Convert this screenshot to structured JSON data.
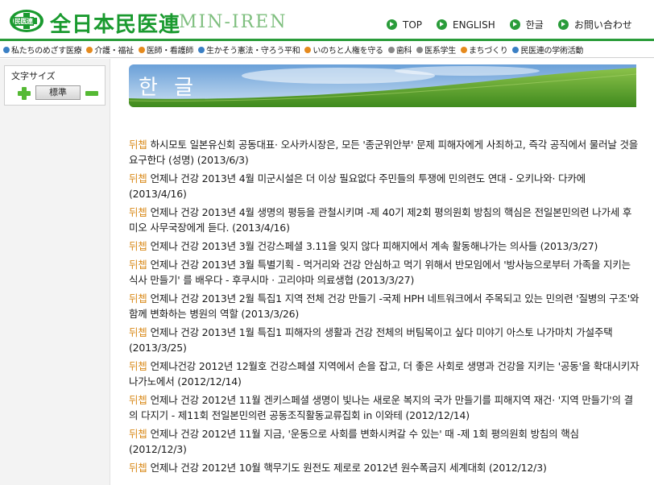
{
  "header": {
    "logo_badge": "民医連",
    "title": "全日本民医連",
    "subtitle": "MIN-IREN",
    "top_nav": [
      "TOP",
      "ENGLISH",
      "한글",
      "お問い合わせ"
    ]
  },
  "subnav": [
    {
      "label": "私たちのめざす医療",
      "color": "#3a7fc4"
    },
    {
      "label": "介護・福祉",
      "color": "#e58a1e"
    },
    {
      "label": "医師・看護師",
      "color": "#e58a1e"
    },
    {
      "label": "生かそう憲法・守ろう平和",
      "color": "#3a7fc4"
    },
    {
      "label": "いのちと人権を守る",
      "color": "#e58a1e"
    },
    {
      "label": "歯科",
      "color": "#888888"
    },
    {
      "label": "医系学生",
      "color": "#888888"
    },
    {
      "label": "まちづくり",
      "color": "#e58a1e"
    },
    {
      "label": "民医連の学術活動",
      "color": "#3a7fc4"
    }
  ],
  "sidebar": {
    "font_size_label": "文字サイズ",
    "standard_label": "標準"
  },
  "banner": {
    "title": "한 글"
  },
  "news": [
    {
      "tag": "뒤쳅",
      "text": "하시모토 일본유신회 공동대표· 오사카시장은,  모든 '종군위안부' 문제 피해자에게 사죄하고,  즉각 공직에서 물러날 것을 요구한다 (성명)  (2013/6/3)"
    },
    {
      "tag": "뒤쳅",
      "text": "언제나 건강 2013년 4월     미군시설은 더 이상 필요없다     주민들의 투쟁에 민의련도 연대 - 오키나와· 다카에     (2013/4/16)"
    },
    {
      "tag": "뒤쳅",
      "text": "언제나 건강 2013년 4월     생명의 평등을 관철시키며     -제 40기 제2회 평의원회 방침의 핵심은     전일본민의련 나가세 후미오 사무국장에게 듣다.    (2013/4/16)"
    },
    {
      "tag": "뒤쳅",
      "text": "언제나 건강 2013년 3월     건강스페셜     3.11을 잊지 않다     피해지에서 계속 활동해나가는 의사들     (2013/3/27)"
    },
    {
      "tag": "뒤쳅",
      "text": "언제나 건강 2013년 3월     특별기획 - 먹거리와 건강     안심하고 먹기 위해서     반모임에서 '방사능으로부터 가족을 지키는 식사 만들기' 를 배우다     - 후쿠시마 · 고리야마 의료생협     (2013/3/27)"
    },
    {
      "tag": "뒤쳅",
      "text": "언제나 건강 2013년 2월     특집1     지역 전체 건강 만들기     -국제 HPH 네트워크에서 주목되고 있는 민의련     '질병의 구조'와 함께 변화하는 병원의 역할     (2013/3/26)"
    },
    {
      "tag": "뒤쳅",
      "text": "언제나 건강 2013년 1월     특집1     피해자의 생활과 건강 전체의 버팀목이고 싶다     미야기 아스토 나가마치 가설주택     (2013/3/25)"
    },
    {
      "tag": "뒤쳅",
      "text": "언제나건강 2012년 12월호     건강스페셜     지역에서 손을 잡고, 더 좋은 사회로     생명과 건강을 지키는 '공동'을 확대시키자     나가노에서     (2012/12/14)"
    },
    {
      "tag": "뒤쳅",
      "text": "언제나 건강 2012년 11월     겐키스페셜     생명이 빛나는 새로운 복지의 국가 만들기를     피해지역 재건· '지역 만들기'의 결의 다지기     -  제11회 전일본민의련 공동조직활동교류집회 in 이와테     (2012/12/14)"
    },
    {
      "tag": "뒤쳅",
      "text": "언제나 건강 2012년 11월     지금, '운동으로 사회를 변화시켜갈 수 있는' 때     -제 1회 평의원회 방침의 핵심     (2012/12/3)"
    },
    {
      "tag": "뒤쳅",
      "text": "언제나 건강 2012년 10월     핵무기도 원전도 제로로     2012년 원수폭금지 세계대회     (2012/12/3)"
    }
  ]
}
